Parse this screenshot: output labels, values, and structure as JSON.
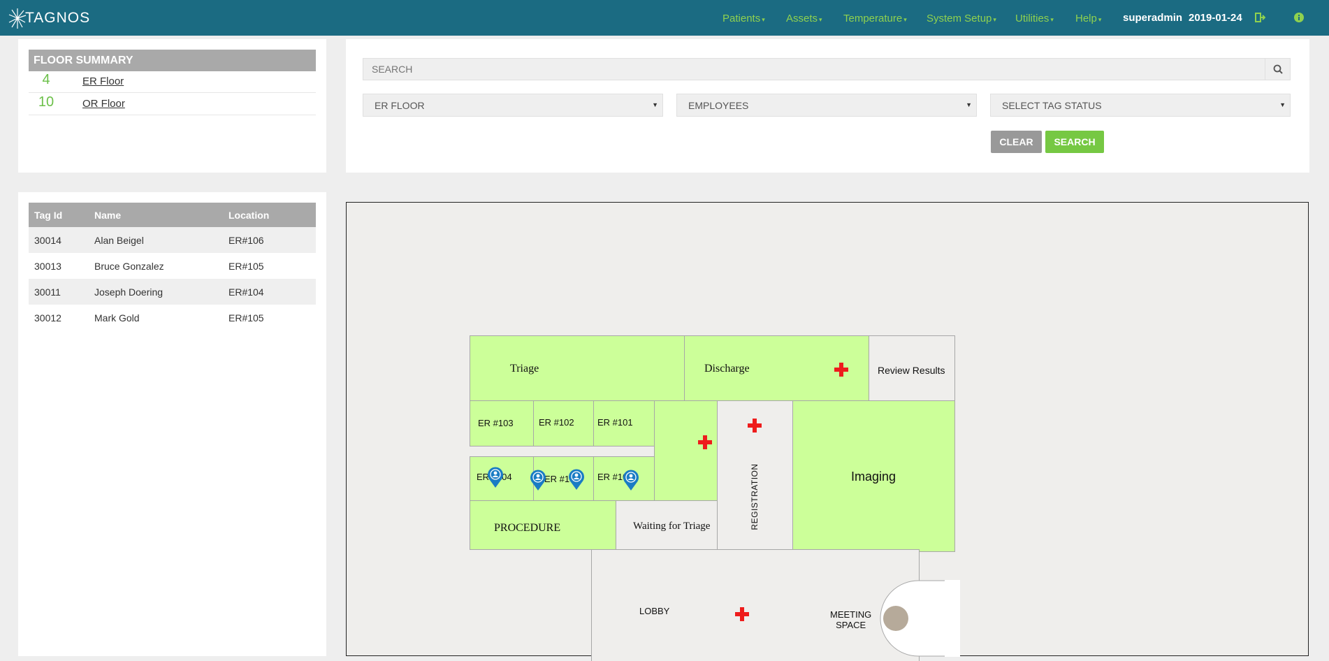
{
  "app": {
    "brand": "TAGNOS"
  },
  "nav": {
    "items": [
      {
        "label": "Patients"
      },
      {
        "label": "Assets"
      },
      {
        "label": "Temperature"
      },
      {
        "label": "System Setup"
      },
      {
        "label": "Utilities"
      },
      {
        "label": "Help"
      }
    ],
    "user": "superadmin",
    "date": "2019-01-24"
  },
  "floor_summary": {
    "title": "FLOOR SUMMARY",
    "floors": [
      {
        "count": "4",
        "name": "ER Floor"
      },
      {
        "count": "10",
        "name": "OR Floor"
      }
    ]
  },
  "search": {
    "placeholder": "SEARCH",
    "floor_select": "ER FLOOR",
    "type_select": "EMPLOYEES",
    "status_select": "SELECT TAG STATUS",
    "clear_label": "CLEAR",
    "search_label": "SEARCH"
  },
  "tags": {
    "headers": [
      "Tag Id",
      "Name",
      "Location"
    ],
    "rows": [
      {
        "id": "30014",
        "name": "Alan Beigel",
        "location": "ER#106"
      },
      {
        "id": "30013",
        "name": "Bruce Gonzalez",
        "location": "ER#105"
      },
      {
        "id": "30011",
        "name": "Joseph Doering",
        "location": "ER#104"
      },
      {
        "id": "30012",
        "name": "Mark Gold",
        "location": "ER#105"
      }
    ]
  },
  "map": {
    "rooms": {
      "triage": "Triage",
      "discharge": "Discharge",
      "review": "Review Results",
      "er103": "ER #103",
      "er102": "ER #102",
      "er101": "ER #101",
      "er104": "ER #104",
      "er105": "ER #105",
      "er106": "ER #106",
      "procedure": "PROCEDURE",
      "waiting": "Waiting for Triage",
      "registration": "REGISTRATION",
      "imaging": "Imaging",
      "lobby": "LOBBY",
      "meeting_line1": "MEETING",
      "meeting_line2": "SPACE"
    }
  },
  "colors": {
    "navbar": "#1b6b82",
    "accent_green": "#8fd14f",
    "room_green": "#ccff99",
    "pin_blue": "#1a7cc4",
    "cross_red": "#ee1c1c"
  }
}
